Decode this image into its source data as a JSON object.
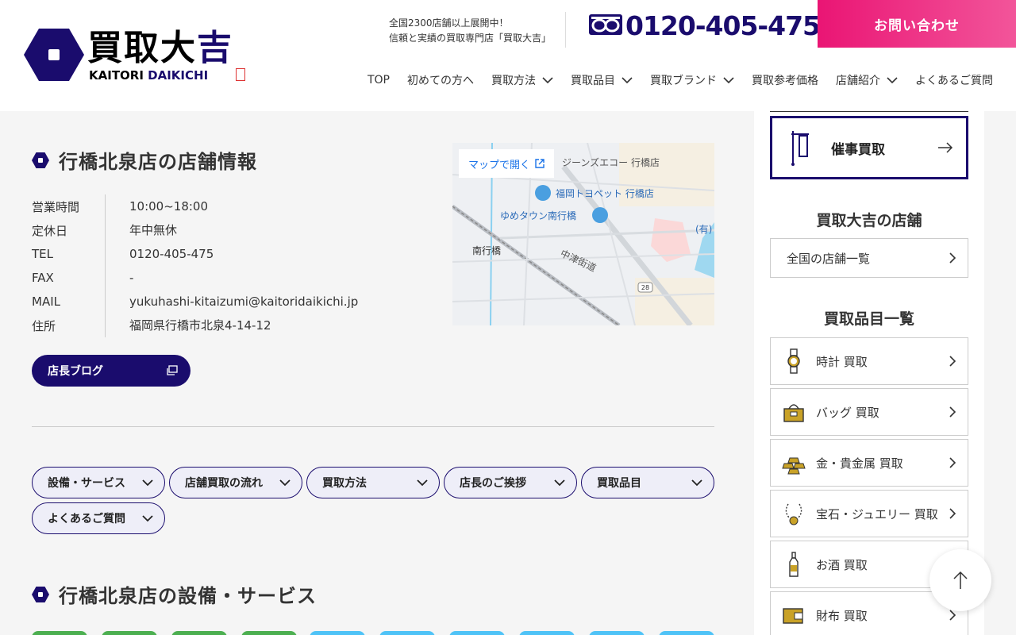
{
  "header": {
    "logo_main_1": "買取大",
    "logo_main_2": "吉",
    "logo_sub_1": "KAITORI ",
    "logo_sub_2": "DAIKICHI",
    "tagline_1": "全国2300店舗以上展開中！",
    "tagline_2": "信頼と実績の買取専門店「買取大吉」",
    "phone": "0120-405-475",
    "contact_label": "お問い合わせ",
    "nav": [
      {
        "label": "TOP",
        "has_dropdown": false
      },
      {
        "label": "初めての方へ",
        "has_dropdown": false
      },
      {
        "label": "買取方法",
        "has_dropdown": true
      },
      {
        "label": "買取品目",
        "has_dropdown": true
      },
      {
        "label": "買取ブランド",
        "has_dropdown": true
      },
      {
        "label": "買取参考価格",
        "has_dropdown": false
      },
      {
        "label": "店舗紹介",
        "has_dropdown": true
      },
      {
        "label": "よくあるご質問",
        "has_dropdown": false
      }
    ]
  },
  "store": {
    "title": "行橋北泉店の店舗情報",
    "info": [
      {
        "label": "営業時間",
        "value": "10:00~18:00"
      },
      {
        "label": "定休日",
        "value": "年中無休"
      },
      {
        "label": "TEL",
        "value": "0120-405-475"
      },
      {
        "label": "FAX",
        "value": "-"
      },
      {
        "label": "MAIL",
        "value": "yukuhashi-kitaizumi@kaitoridaikichi.jp"
      },
      {
        "label": "住所",
        "value": "福岡県行橋市北泉4-14-12"
      }
    ],
    "blog_label": "店長ブログ",
    "map": {
      "open_label": "マップで開く",
      "labels": {
        "jeans": "ジーンズエコー 行橋店",
        "toyopet": "福岡トヨペット 行橋店",
        "youme": "ゆめタウン南行橋",
        "station": "南行橋",
        "street": "中津街道",
        "route": "28",
        "yu": "(有)"
      }
    },
    "pills": [
      "設備・サービス",
      "店舗買取の流れ",
      "買取方法",
      "店長のご挨拶",
      "買取品目",
      "よくあるご質問"
    ],
    "services_title": "行橋北泉店の設備・サービス"
  },
  "sidebar": {
    "event_label": "催事買取",
    "stores_heading": "買取大吉の店舗",
    "stores_link": "全国の店舗一覧",
    "items_heading": "買取品目一覧",
    "items": [
      {
        "label": "時計 買取",
        "icon": "watch-icon"
      },
      {
        "label": "バッグ 買取",
        "icon": "bag-icon"
      },
      {
        "label": "金・貴金属 買取",
        "icon": "gold-icon"
      },
      {
        "label": "宝石・ジュエリー 買取",
        "icon": "jewelry-icon"
      },
      {
        "label": "お酒 買取",
        "icon": "bottle-icon"
      },
      {
        "label": "財布 買取",
        "icon": "wallet-icon"
      }
    ]
  },
  "colors": {
    "brand": "#1a0c6d",
    "accent_pink": "#ea1574",
    "icon_gold": "#c9a227",
    "badge_green": "#4caf50",
    "badge_blue": "#4fc3f7"
  }
}
